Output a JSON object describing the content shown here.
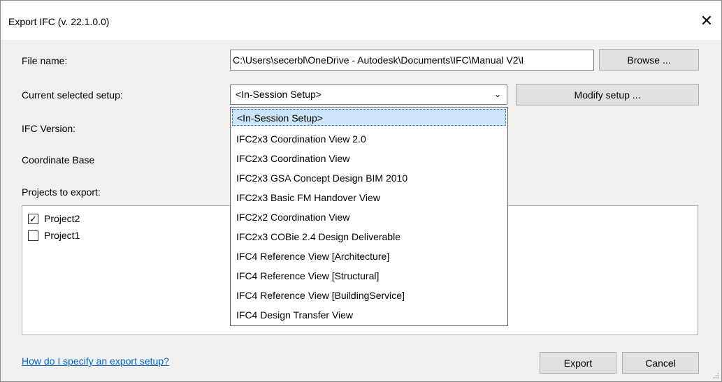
{
  "window": {
    "title": "Export IFC (v. 22.1.0.0)",
    "close_glyph": "✕"
  },
  "labels": {
    "file_name": "File name:",
    "current_setup": "Current selected setup:",
    "ifc_version": "IFC Version:",
    "coordinate_base": "Coordinate Base",
    "projects_to_export": "Projects to export:"
  },
  "file_name_value": "C:\\Users\\secerbl\\OneDrive - Autodesk\\Documents\\IFC\\Manual V2\\I",
  "buttons": {
    "browse": "Browse ...",
    "modify_setup": "Modify setup ...",
    "export": "Export",
    "cancel": "Cancel"
  },
  "setup_combo": {
    "value": "<In-Session Setup>",
    "arrow": "⌄"
  },
  "setup_options": [
    "<In-Session Setup>",
    "IFC2x3 Coordination View 2.0",
    "IFC2x3 Coordination View",
    "IFC2x3 GSA Concept Design BIM 2010",
    "IFC2x3 Basic FM Handover View",
    "IFC2x2 Coordination View",
    "IFC2x3 COBie 2.4 Design Deliverable",
    "IFC4 Reference View [Architecture]",
    "IFC4 Reference View [Structural]",
    "IFC4 Reference View [BuildingService]",
    "IFC4 Design Transfer View"
  ],
  "selected_option_index": 0,
  "projects": [
    {
      "name": "Project2",
      "checked": true,
      "mark": "✓"
    },
    {
      "name": "Project1",
      "checked": false,
      "mark": ""
    }
  ],
  "help_link": "How do I specify an export setup?"
}
